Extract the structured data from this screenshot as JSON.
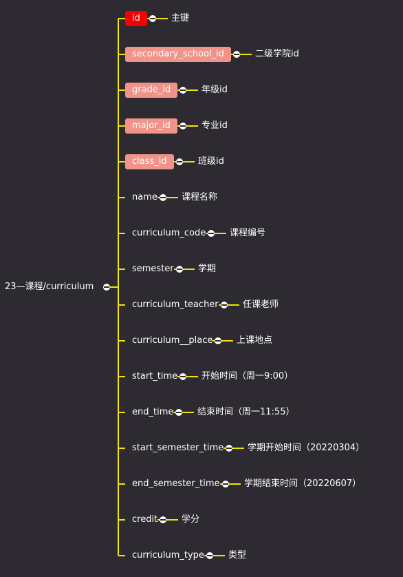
{
  "colors": {
    "background": "#2d2a31",
    "line": "#f5e400",
    "primary_key": "#f50000",
    "foreign_key": "#f0938a",
    "text": "#ffffff"
  },
  "root": {
    "label": "23—课程/curriculum"
  },
  "fields": [
    {
      "name": "id",
      "desc": "主键",
      "kind": "primary"
    },
    {
      "name": "secondary_school_id",
      "desc": "二级学院id",
      "kind": "foreign"
    },
    {
      "name": "grade_id",
      "desc": "年级id",
      "kind": "foreign"
    },
    {
      "name": "major_id",
      "desc": "专业id",
      "kind": "foreign"
    },
    {
      "name": "class_id",
      "desc": "班级id",
      "kind": "foreign"
    },
    {
      "name": "name",
      "desc": "课程名称",
      "kind": "plain"
    },
    {
      "name": "curriculum_code",
      "desc": "课程编号",
      "kind": "plain"
    },
    {
      "name": "semester",
      "desc": "学期",
      "kind": "plain"
    },
    {
      "name": "curriculum_teacher",
      "desc": "任课老师",
      "kind": "plain"
    },
    {
      "name": "curriculum__place",
      "desc": "上课地点",
      "kind": "plain"
    },
    {
      "name": "start_time",
      "desc": "开始时间（周一9:00）",
      "kind": "plain"
    },
    {
      "name": "end_time",
      "desc": "结束时间（周一11:55）",
      "kind": "plain"
    },
    {
      "name": "start_semester_time",
      "desc": "学期开始时间（20220304）",
      "kind": "plain"
    },
    {
      "name": "end_semester_time",
      "desc": "学期结束时间（20220607）",
      "kind": "plain"
    },
    {
      "name": "credit",
      "desc": "学分",
      "kind": "plain"
    },
    {
      "name": "curriculum_type",
      "desc": "类型",
      "kind": "plain"
    }
  ]
}
